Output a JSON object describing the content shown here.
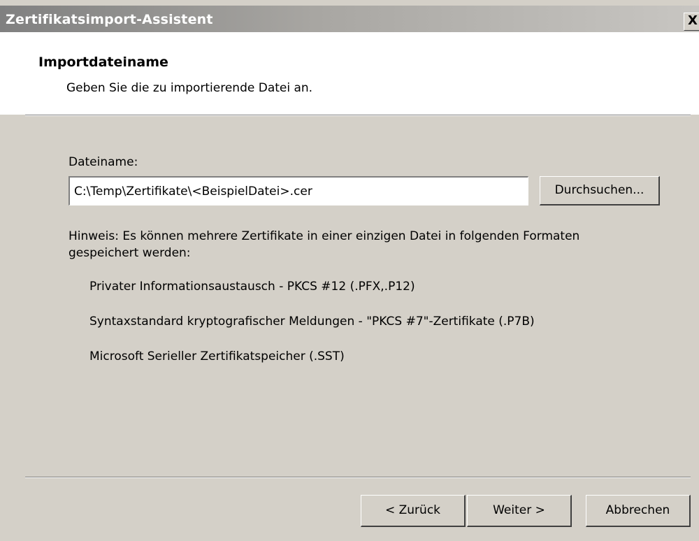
{
  "window": {
    "title": "Zertifikatsimport-Assistent",
    "close_label": "X"
  },
  "header": {
    "title": "Importdateiname",
    "subtitle": "Geben Sie die zu importierende Datei an."
  },
  "file": {
    "label": "Dateiname:",
    "value": "C:\\Temp\\Zertifikate\\<BeispielDatei>.cer",
    "browse_label": "Durchsuchen..."
  },
  "note": {
    "line1": "Hinweis: Es können mehrere Zertifikate in einer einzigen Datei in folgenden Formaten",
    "line2": "gespeichert werden:",
    "formats": [
      "Privater Informationsaustausch - PKCS #12 (.PFX,.P12)",
      "Syntaxstandard kryptografischer Meldungen - \"PKCS #7\"-Zertifikate (.P7B)",
      "Microsoft Serieller Zertifikatspeicher (.SST)"
    ]
  },
  "footer": {
    "back_label": "< Zurück",
    "next_label": "Weiter >",
    "cancel_label": "Abbrechen"
  }
}
